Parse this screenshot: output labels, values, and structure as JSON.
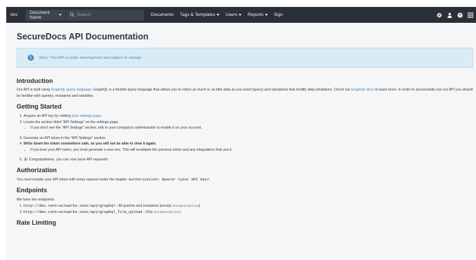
{
  "nav": {
    "env_label": "dev",
    "scope_label": "Document Name",
    "search_placeholder": "Search",
    "menu": [
      {
        "label": "Documents",
        "dropdown": false
      },
      {
        "label": "Tags & Templates",
        "dropdown": true
      },
      {
        "label": "Users",
        "dropdown": true
      },
      {
        "label": "Reports",
        "dropdown": true
      },
      {
        "label": "Sign",
        "dropdown": false
      }
    ],
    "icons": [
      "gear-icon",
      "user-icon",
      "help-icon",
      "grid-icon"
    ]
  },
  "page": {
    "title": "SecureDocs API Documentation",
    "note": "Note: This API is under development and subject to change."
  },
  "intro": {
    "heading": "Introduction",
    "p1_a": "Our API is built using ",
    "p1_link1": "GraphQL query language",
    "p1_b": ". GraphQL is a flexible query language that allows you to return as much or as little data as you need (query) and operations that modify data (mutation). Check out ",
    "p1_link2": "GraphQL docs",
    "p1_c": " to learn more. In order to successfully use our API you should be familiar with queries, mutations and variables."
  },
  "getting_started": {
    "heading": "Getting Started",
    "s1_a": "Acquire an API key by visiting ",
    "s1_link": "your settings page",
    "s1_b": ".",
    "s2": "Locate the section titled \"API Settings\" on the settings page.",
    "s2_sub": "If you don't see the \"API Settings\" section, talk to your company's administrator to enable it on your account.",
    "s3": "Generate an API token in the \"API Settings\" section.",
    "s4": "Write down the token somewhere safe, as you will not be able to view it again.",
    "s4_sub": "If you lose your API token, you must generate a new one. This will invalidate the previous token and any integrations that use it.",
    "s5": "🎉 Congratulations, you can now issue API requests!"
  },
  "authorization": {
    "heading": "Authorization",
    "text_a": "You must include your API token with every request under the header: ",
    "code": "Authorization: Bearer <your API key>",
    "text_b": " ."
  },
  "endpoints": {
    "heading": "Endpoints",
    "intro": "We have two endpoints:",
    "items": [
      {
        "url": "http://dev.contractworks.test/api/graphql",
        "desc_a": " - All queries and mutations (except ",
        "code": "documentUpload",
        "desc_b": ")"
      },
      {
        "url": "http://dev.contractworks.test/api/graphql_file_upload",
        "desc_a": " - Only ",
        "code": "documentUpload",
        "desc_b": "."
      }
    ]
  },
  "rate_limiting": {
    "heading": "Rate Limiting"
  }
}
